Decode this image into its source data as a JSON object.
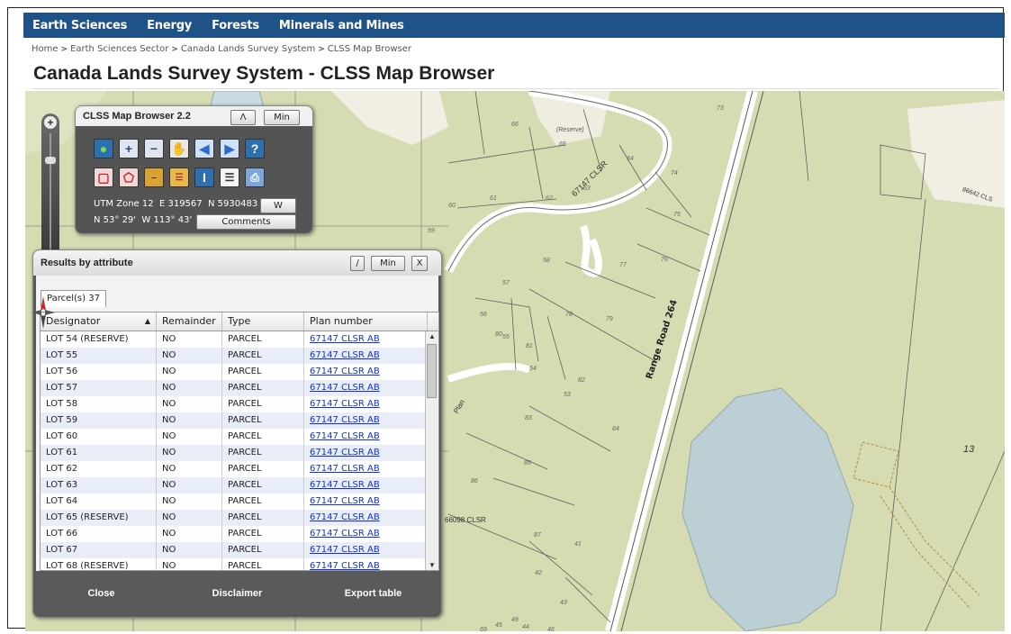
{
  "nav": {
    "items": [
      "Earth Sciences",
      "Energy",
      "Forests",
      "Minerals and Mines"
    ]
  },
  "breadcrumb": [
    "Home",
    "Earth Sciences Sector",
    "Canada Lands Survey System",
    "CLSS Map Browser"
  ],
  "page_title": "Canada Lands Survey System - CLSS Map Browser",
  "toolbar_panel": {
    "title": "CLSS Map Browser 2.2",
    "collapse_label": "Λ",
    "min_label": "Min",
    "tools": [
      {
        "name": "globe-icon"
      },
      {
        "name": "zoom-in-icon"
      },
      {
        "name": "zoom-out-icon"
      },
      {
        "name": "pan-hand-icon"
      },
      {
        "name": "back-arrow-icon"
      },
      {
        "name": "forward-arrow-icon"
      },
      {
        "name": "help-icon"
      },
      {
        "name": "select-rectangle-icon"
      },
      {
        "name": "select-polygon-icon"
      },
      {
        "name": "measure-icon"
      },
      {
        "name": "layers-icon"
      },
      {
        "name": "identify-icon"
      },
      {
        "name": "list-icon"
      },
      {
        "name": "print-icon"
      }
    ],
    "utm_zone": "UTM Zone 12",
    "easting": "E 319567",
    "northing": "N 5930483",
    "utm_toggle_label": "W",
    "latlon": "N 53° 29'  W 113° 43'",
    "comments_label": "Comments"
  },
  "results": {
    "title": "Results by attribute",
    "slash_label": "/",
    "min_label": "Min",
    "close_x_label": "X",
    "tab_label": "Parcel(s) 37",
    "columns": [
      "Designator",
      "Remainder",
      "Type",
      "Plan number"
    ],
    "sort_indicator": "▲",
    "rows": [
      [
        "LOT 54 (RESERVE)",
        "NO",
        "PARCEL",
        "67147 CLSR AB"
      ],
      [
        "LOT 55",
        "NO",
        "PARCEL",
        "67147 CLSR AB"
      ],
      [
        "LOT 56",
        "NO",
        "PARCEL",
        "67147 CLSR AB"
      ],
      [
        "LOT 57",
        "NO",
        "PARCEL",
        "67147 CLSR AB"
      ],
      [
        "LOT 58",
        "NO",
        "PARCEL",
        "67147 CLSR AB"
      ],
      [
        "LOT 59",
        "NO",
        "PARCEL",
        "67147 CLSR AB"
      ],
      [
        "LOT 60",
        "NO",
        "PARCEL",
        "67147 CLSR AB"
      ],
      [
        "LOT 61",
        "NO",
        "PARCEL",
        "67147 CLSR AB"
      ],
      [
        "LOT 62",
        "NO",
        "PARCEL",
        "67147 CLSR AB"
      ],
      [
        "LOT 63",
        "NO",
        "PARCEL",
        "67147 CLSR AB"
      ],
      [
        "LOT 64",
        "NO",
        "PARCEL",
        "67147 CLSR AB"
      ],
      [
        "LOT 65 (RESERVE)",
        "NO",
        "PARCEL",
        "67147 CLSR AB"
      ],
      [
        "LOT 66",
        "NO",
        "PARCEL",
        "67147 CLSR AB"
      ],
      [
        "LOT 67",
        "NO",
        "PARCEL",
        "67147 CLSR AB"
      ],
      [
        "LOT 68 (RESERVE)",
        "NO",
        "PARCEL",
        "67147 CLSR AB"
      ]
    ],
    "footer": {
      "close_label": "Close",
      "disclaimer_label": "Disclaimer",
      "export_label": "Export table"
    }
  },
  "map_labels": {
    "road": "Range Road 264",
    "lot_13": "13",
    "plan_67147": "67147 CLSR",
    "plan_66098": "66098 CLSR",
    "plan_86642": "86642 CLS",
    "reserve": "(Reserve)",
    "plan_side": "Plan",
    "lots": [
      "66",
      "65",
      "64",
      "63",
      "62",
      "61",
      "60",
      "59",
      "58",
      "57",
      "56",
      "55",
      "54",
      "53",
      "73",
      "74",
      "75",
      "76",
      "77",
      "78",
      "79",
      "80",
      "81",
      "82",
      "83",
      "84",
      "85",
      "86",
      "87",
      "41",
      "42",
      "43",
      "44",
      "45",
      "46",
      "49",
      "69"
    ]
  },
  "colors": {
    "nav_bg": "#1f5286",
    "map_land": "#d6dbb2",
    "link": "#1133cc"
  }
}
